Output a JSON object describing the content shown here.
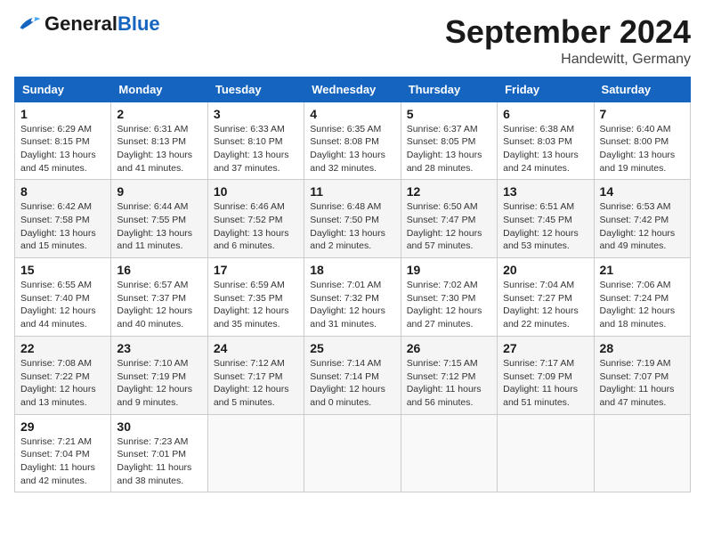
{
  "header": {
    "logo_general": "General",
    "logo_blue": "Blue",
    "month": "September 2024",
    "location": "Handewitt, Germany"
  },
  "weekdays": [
    "Sunday",
    "Monday",
    "Tuesday",
    "Wednesday",
    "Thursday",
    "Friday",
    "Saturday"
  ],
  "weeks": [
    [
      {
        "day": "1",
        "sunrise": "6:29 AM",
        "sunset": "8:15 PM",
        "daylight": "13 hours and 45 minutes."
      },
      {
        "day": "2",
        "sunrise": "6:31 AM",
        "sunset": "8:13 PM",
        "daylight": "13 hours and 41 minutes."
      },
      {
        "day": "3",
        "sunrise": "6:33 AM",
        "sunset": "8:10 PM",
        "daylight": "13 hours and 37 minutes."
      },
      {
        "day": "4",
        "sunrise": "6:35 AM",
        "sunset": "8:08 PM",
        "daylight": "13 hours and 32 minutes."
      },
      {
        "day": "5",
        "sunrise": "6:37 AM",
        "sunset": "8:05 PM",
        "daylight": "13 hours and 28 minutes."
      },
      {
        "day": "6",
        "sunrise": "6:38 AM",
        "sunset": "8:03 PM",
        "daylight": "13 hours and 24 minutes."
      },
      {
        "day": "7",
        "sunrise": "6:40 AM",
        "sunset": "8:00 PM",
        "daylight": "13 hours and 19 minutes."
      }
    ],
    [
      {
        "day": "8",
        "sunrise": "6:42 AM",
        "sunset": "7:58 PM",
        "daylight": "13 hours and 15 minutes."
      },
      {
        "day": "9",
        "sunrise": "6:44 AM",
        "sunset": "7:55 PM",
        "daylight": "13 hours and 11 minutes."
      },
      {
        "day": "10",
        "sunrise": "6:46 AM",
        "sunset": "7:52 PM",
        "daylight": "13 hours and 6 minutes."
      },
      {
        "day": "11",
        "sunrise": "6:48 AM",
        "sunset": "7:50 PM",
        "daylight": "13 hours and 2 minutes."
      },
      {
        "day": "12",
        "sunrise": "6:50 AM",
        "sunset": "7:47 PM",
        "daylight": "12 hours and 57 minutes."
      },
      {
        "day": "13",
        "sunrise": "6:51 AM",
        "sunset": "7:45 PM",
        "daylight": "12 hours and 53 minutes."
      },
      {
        "day": "14",
        "sunrise": "6:53 AM",
        "sunset": "7:42 PM",
        "daylight": "12 hours and 49 minutes."
      }
    ],
    [
      {
        "day": "15",
        "sunrise": "6:55 AM",
        "sunset": "7:40 PM",
        "daylight": "12 hours and 44 minutes."
      },
      {
        "day": "16",
        "sunrise": "6:57 AM",
        "sunset": "7:37 PM",
        "daylight": "12 hours and 40 minutes."
      },
      {
        "day": "17",
        "sunrise": "6:59 AM",
        "sunset": "7:35 PM",
        "daylight": "12 hours and 35 minutes."
      },
      {
        "day": "18",
        "sunrise": "7:01 AM",
        "sunset": "7:32 PM",
        "daylight": "12 hours and 31 minutes."
      },
      {
        "day": "19",
        "sunrise": "7:02 AM",
        "sunset": "7:30 PM",
        "daylight": "12 hours and 27 minutes."
      },
      {
        "day": "20",
        "sunrise": "7:04 AM",
        "sunset": "7:27 PM",
        "daylight": "12 hours and 22 minutes."
      },
      {
        "day": "21",
        "sunrise": "7:06 AM",
        "sunset": "7:24 PM",
        "daylight": "12 hours and 18 minutes."
      }
    ],
    [
      {
        "day": "22",
        "sunrise": "7:08 AM",
        "sunset": "7:22 PM",
        "daylight": "12 hours and 13 minutes."
      },
      {
        "day": "23",
        "sunrise": "7:10 AM",
        "sunset": "7:19 PM",
        "daylight": "12 hours and 9 minutes."
      },
      {
        "day": "24",
        "sunrise": "7:12 AM",
        "sunset": "7:17 PM",
        "daylight": "12 hours and 5 minutes."
      },
      {
        "day": "25",
        "sunrise": "7:14 AM",
        "sunset": "7:14 PM",
        "daylight": "12 hours and 0 minutes."
      },
      {
        "day": "26",
        "sunrise": "7:15 AM",
        "sunset": "7:12 PM",
        "daylight": "11 hours and 56 minutes."
      },
      {
        "day": "27",
        "sunrise": "7:17 AM",
        "sunset": "7:09 PM",
        "daylight": "11 hours and 51 minutes."
      },
      {
        "day": "28",
        "sunrise": "7:19 AM",
        "sunset": "7:07 PM",
        "daylight": "11 hours and 47 minutes."
      }
    ],
    [
      {
        "day": "29",
        "sunrise": "7:21 AM",
        "sunset": "7:04 PM",
        "daylight": "11 hours and 42 minutes."
      },
      {
        "day": "30",
        "sunrise": "7:23 AM",
        "sunset": "7:01 PM",
        "daylight": "11 hours and 38 minutes."
      },
      null,
      null,
      null,
      null,
      null
    ]
  ]
}
